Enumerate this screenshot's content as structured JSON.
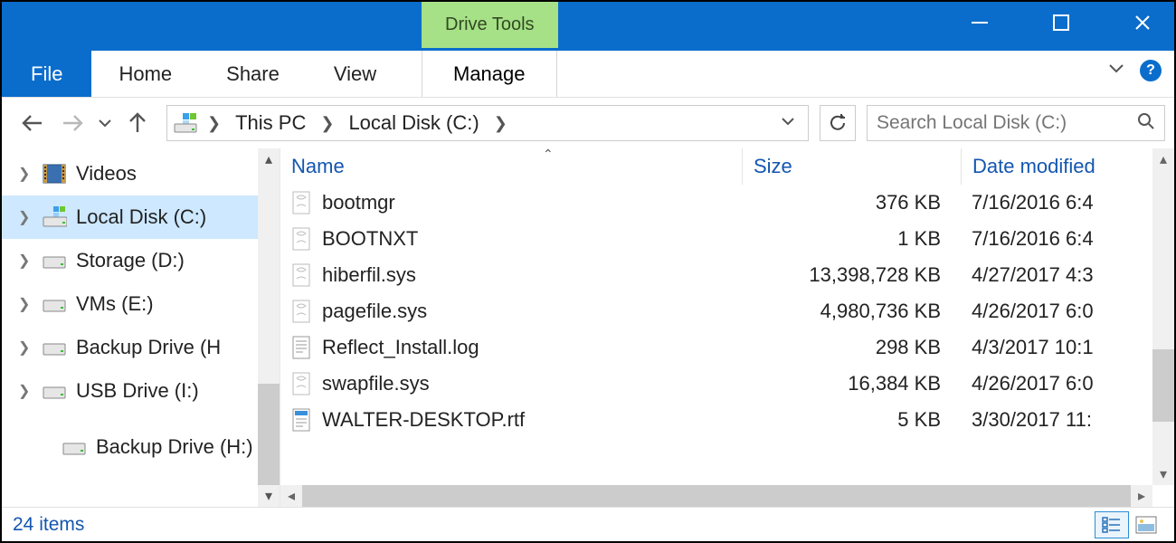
{
  "titlebar": {
    "contextual_tab": "Drive Tools"
  },
  "ribbon": {
    "file": "File",
    "tabs": [
      "Home",
      "Share",
      "View"
    ],
    "contextual": "Manage"
  },
  "breadcrumb": {
    "items": [
      "This PC",
      "Local Disk (C:)"
    ]
  },
  "search": {
    "placeholder": "Search Local Disk (C:)"
  },
  "tree": {
    "items": [
      {
        "label": "Videos",
        "icon": "videos",
        "expandable": true
      },
      {
        "label": "Local Disk (C:)",
        "icon": "cdrive",
        "expandable": true,
        "selected": true
      },
      {
        "label": "Storage (D:)",
        "icon": "drive",
        "expandable": true
      },
      {
        "label": "VMs (E:)",
        "icon": "drive",
        "expandable": true
      },
      {
        "label": "Backup Drive (H:)",
        "icon": "drive",
        "expandable": true,
        "truncated": "Backup Drive (H"
      },
      {
        "label": "USB Drive (I:)",
        "icon": "drive",
        "expandable": true
      },
      {
        "label": "Backup Drive (H:)",
        "icon": "drive",
        "expandable": false
      }
    ]
  },
  "columns": {
    "name": "Name",
    "size": "Size",
    "date": "Date modified"
  },
  "files": [
    {
      "name": "bootmgr",
      "size": "376 KB",
      "date": "7/16/2016 6:4",
      "icon": "sys"
    },
    {
      "name": "BOOTNXT",
      "size": "1 KB",
      "date": "7/16/2016 6:4",
      "icon": "sys"
    },
    {
      "name": "hiberfil.sys",
      "size": "13,398,728 KB",
      "date": "4/27/2017 4:3",
      "icon": "sys"
    },
    {
      "name": "pagefile.sys",
      "size": "4,980,736 KB",
      "date": "4/26/2017 6:0",
      "icon": "sys"
    },
    {
      "name": "Reflect_Install.log",
      "size": "298 KB",
      "date": "4/3/2017 10:1",
      "icon": "log"
    },
    {
      "name": "swapfile.sys",
      "size": "16,384 KB",
      "date": "4/26/2017 6:0",
      "icon": "sys"
    },
    {
      "name": "WALTER-DESKTOP.rtf",
      "size": "5 KB",
      "date": "3/30/2017 11:",
      "icon": "rtf"
    }
  ],
  "status": {
    "item_count": "24 items"
  }
}
